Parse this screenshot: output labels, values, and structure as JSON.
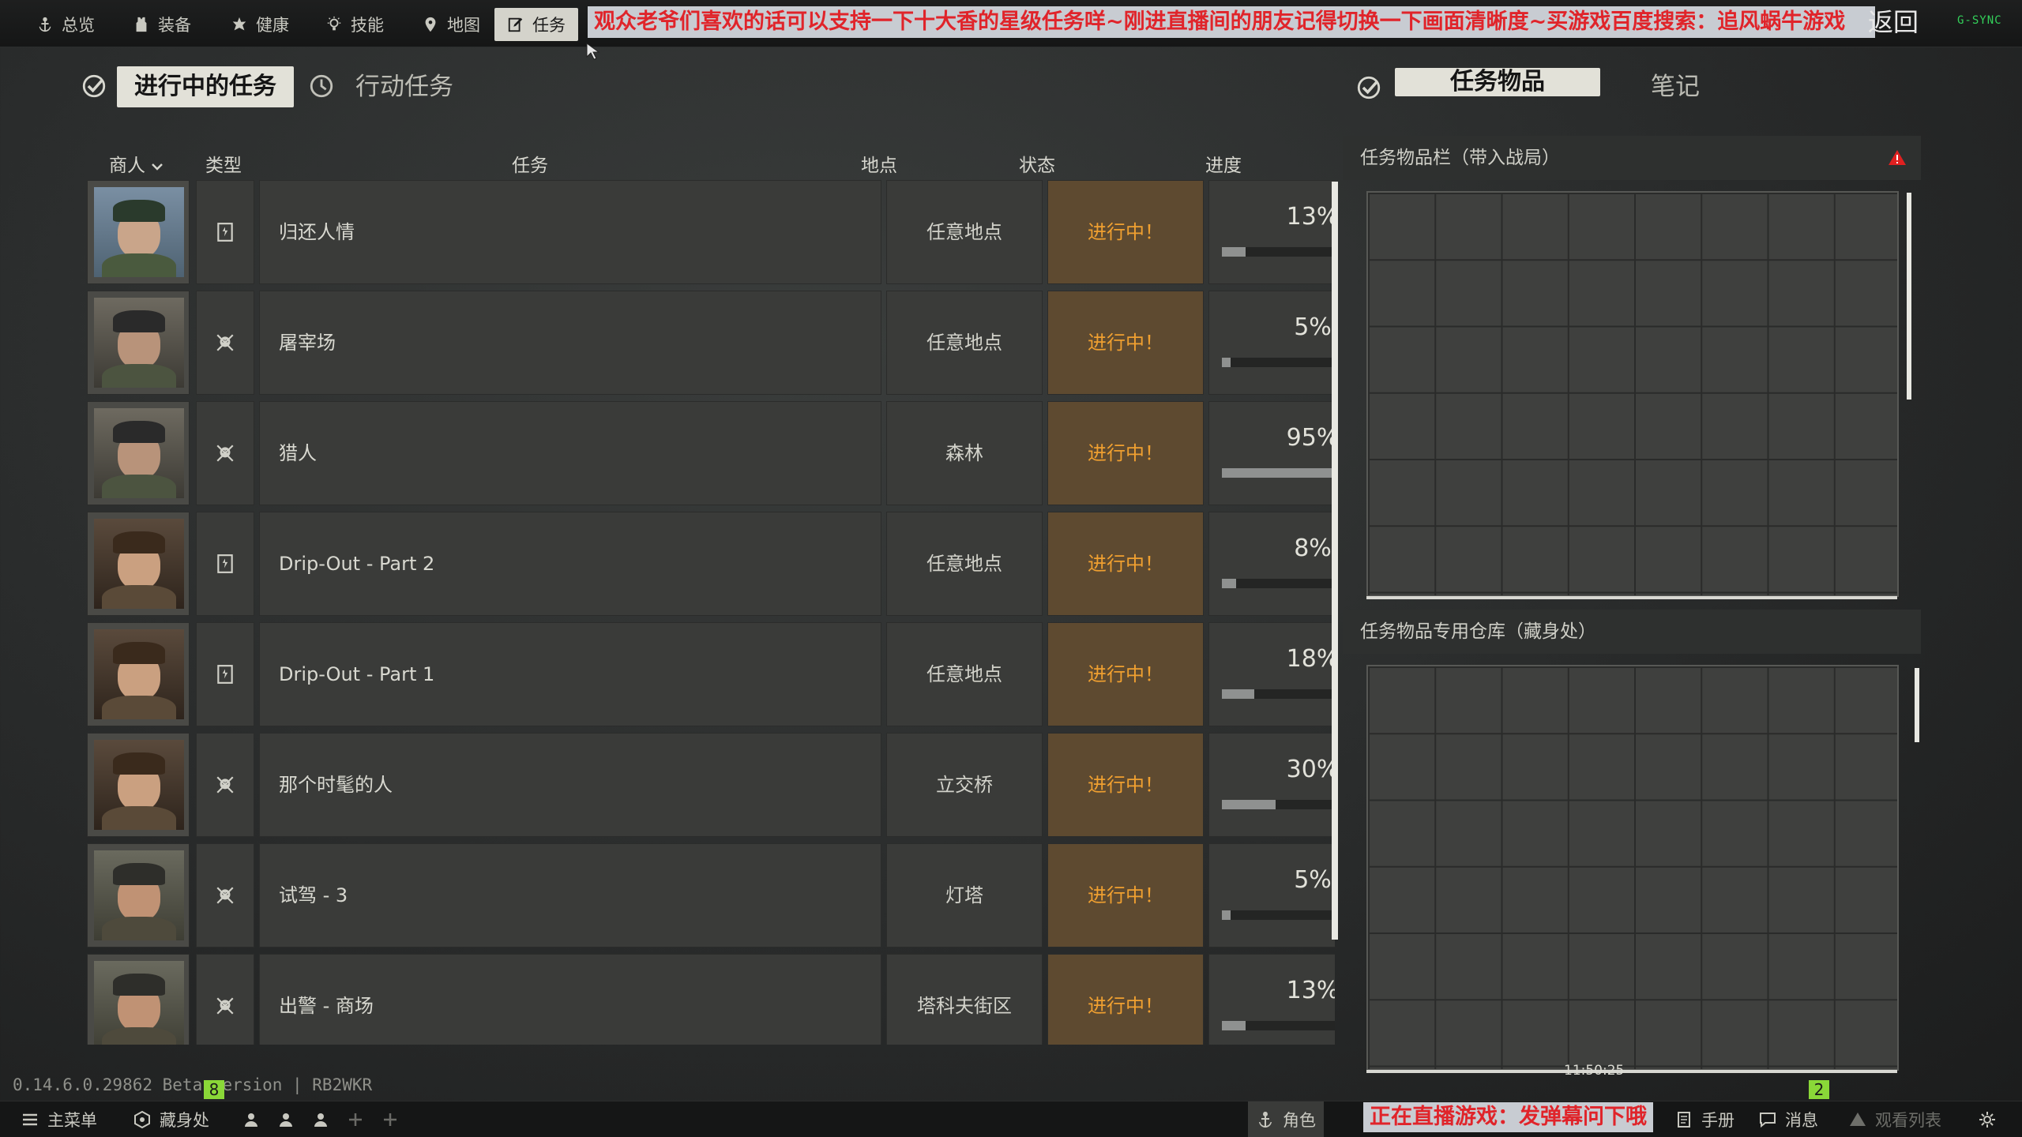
{
  "top_nav": {
    "tabs": [
      {
        "label": "总览",
        "icon": "anchor-icon"
      },
      {
        "label": "装备",
        "icon": "vest-icon"
      },
      {
        "label": "健康",
        "icon": "medical-icon"
      },
      {
        "label": "技能",
        "icon": "bulb-icon"
      },
      {
        "label": "地图",
        "icon": "map-pin-icon"
      },
      {
        "label": "任务",
        "icon": "task-edit-icon",
        "active": true
      }
    ],
    "banner": "观众老爷们喜欢的话可以支持一下十大香的星级任务咩~刚进直播间的朋友记得切换一下画面清晰度~买游戏百度搜索：追风蜗牛游戏",
    "return_label": "返回",
    "gsync": "G-SYNC"
  },
  "subheader": {
    "active_tasks_label": "进行中的任务",
    "action_tasks_label": "行动任务",
    "quest_items_label": "任务物品",
    "notes_label": "笔记"
  },
  "table": {
    "headers": {
      "trader": "商人",
      "type": "类型",
      "task": "任务",
      "location": "地点",
      "status": "状态",
      "progress": "进度"
    },
    "rows": [
      {
        "trader": "prapor",
        "type": "extract",
        "task": "归还人情",
        "location": "任意地点",
        "status": "进行中！",
        "progress_text": "13%",
        "progress": 0.13
      },
      {
        "trader": "jaeger",
        "type": "kill",
        "task": "屠宰场",
        "location": "任意地点",
        "status": "进行中！",
        "progress_text": "5%",
        "progress": 0.05
      },
      {
        "trader": "jaeger",
        "type": "kill",
        "task": "猎人",
        "location": "森林",
        "status": "进行中！",
        "progress_text": "95%",
        "progress": 0.95
      },
      {
        "trader": "ragman",
        "type": "extract",
        "task": "Drip-Out - Part 2",
        "location": "任意地点",
        "status": "进行中！",
        "progress_text": "8%",
        "progress": 0.08
      },
      {
        "trader": "ragman",
        "type": "extract",
        "task": "Drip-Out - Part 1",
        "location": "任意地点",
        "status": "进行中！",
        "progress_text": "18%",
        "progress": 0.18
      },
      {
        "trader": "ragman",
        "type": "kill",
        "task": "那个时髦的人",
        "location": "立交桥",
        "status": "进行中！",
        "progress_text": "30%",
        "progress": 0.3
      },
      {
        "trader": "mechanic",
        "type": "kill",
        "task": "试驾 - 3",
        "location": "灯塔",
        "status": "进行中！",
        "progress_text": "5%",
        "progress": 0.05
      },
      {
        "trader": "mechanic",
        "type": "kill",
        "task": "出警 - 商场",
        "location": "塔科夫街区",
        "status": "进行中！",
        "progress_text": "13%",
        "progress": 0.13
      }
    ]
  },
  "right_panel": {
    "stash_in_raid_title": "任务物品栏（带入战局）",
    "hideout_stash_title": "任务物品专用仓库（藏身处）"
  },
  "footer": {
    "version": "0.14.6.0.29862 Beta version | RB2WKR",
    "main_menu": "主菜单",
    "hideout": "藏身处",
    "character": "角色",
    "stream_msg": "正在直播游戏：发弹幕问下哦",
    "handbook": "手册",
    "messages": "消息",
    "watchlist": "观看列表",
    "badge_left": "8",
    "badge_right": "2",
    "clock": "11:50:25"
  },
  "colors": {
    "status_bg": "#5e4a30",
    "status_text": "#f0a030",
    "banner_text": "#e0242a",
    "alert": "#e02020"
  }
}
